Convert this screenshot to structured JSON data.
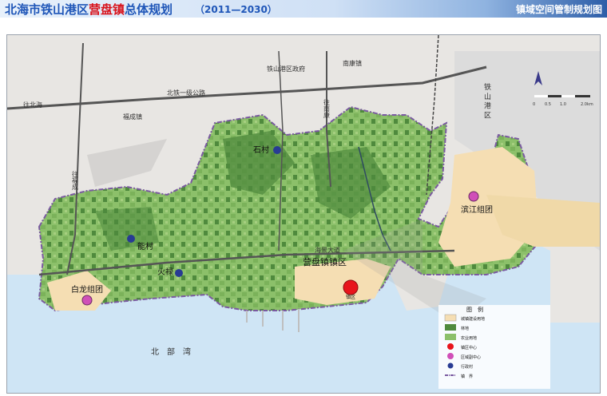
{
  "header": {
    "title_part1": "北海市铁山港区",
    "title_part2": "营盘镇",
    "title_part3": "总体规划",
    "title_years": "（2011—2030）",
    "map_name": "镇域空间管制规划图"
  },
  "map": {
    "towns": {
      "tieshangang_govt": "铁山港区政府",
      "nankang": "南康镇",
      "fucheng": "福成镇",
      "tieshangang_district": "铁 山 港 区",
      "yingpan_town_area": "营盘镇镇区"
    },
    "roads": {
      "beitie_highway": "北铁一级公路",
      "to_beihai": "往北海",
      "to_fucheng": "往福成",
      "to_nankang": "往南康",
      "binhai_avenue": "海景大道"
    },
    "villages": [
      "石村",
      "能村",
      "火禄"
    ],
    "groups": [
      "白龙组团",
      "滨江组团"
    ],
    "sea": "北　部　湾",
    "scale_labels": [
      "0",
      "0.5",
      "1.0",
      "2.0km"
    ],
    "town_center_label": "镇区"
  },
  "legend": {
    "title": "图　例",
    "items": [
      {
        "label": "城镇建设用地",
        "color": "#f5deb3",
        "shape": "rect"
      },
      {
        "label": "林地",
        "color": "#4f8a3d",
        "shape": "rect"
      },
      {
        "label": "农业用地",
        "color": "#8cc06a",
        "shape": "rect"
      },
      {
        "label": "镇区中心",
        "color": "#e8141b",
        "shape": "circle"
      },
      {
        "label": "区域副中心",
        "color": "#d04fb8",
        "shape": "circle"
      },
      {
        "label": "行政村",
        "color": "#283b93",
        "shape": "circle"
      },
      {
        "label": "镇　界",
        "color": "#7a5aa0",
        "shape": "line"
      }
    ]
  },
  "colors": {
    "sea": "#cfe5f5",
    "land_outside": "#e8e6e3",
    "farmland": "#8cc06a",
    "forest": "#4f8a3d",
    "urban": "#f5deb3",
    "road": "#555555",
    "boundary": "#7a5aa0",
    "town_center": "#e8141b",
    "sub_center": "#d04fb8",
    "village": "#283b93"
  }
}
